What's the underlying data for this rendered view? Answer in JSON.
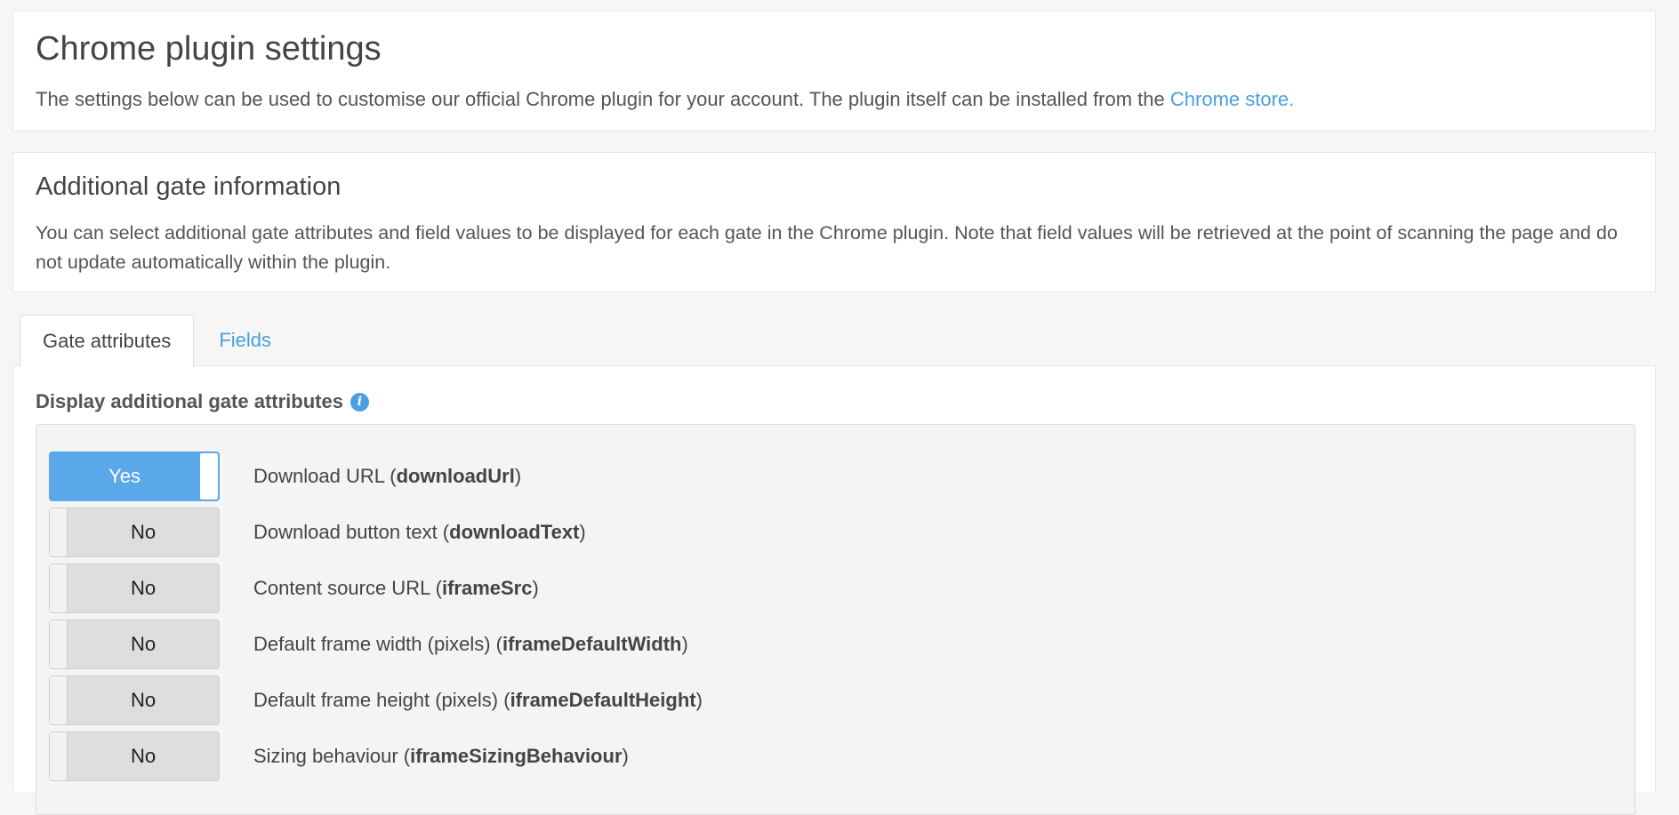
{
  "header": {
    "title": "Chrome plugin settings",
    "intro": "The settings below can be used to customise our official Chrome plugin for your account. The plugin itself can be installed from the ",
    "store_link": "Chrome store."
  },
  "gate_info": {
    "title": "Additional gate information",
    "description": "You can select additional gate attributes and field values to be displayed for each gate in the Chrome plugin. Note that field values will be retrieved at the point of scanning the page and do not update automatically within the plugin."
  },
  "tabs": [
    {
      "label": "Gate attributes",
      "active": true
    },
    {
      "label": "Fields",
      "active": false
    }
  ],
  "panel": {
    "heading": "Display additional gate attributes",
    "info_icon": "info-icon",
    "attributes": [
      {
        "toggle": "Yes",
        "on": true,
        "label": "Download URL (",
        "key": "downloadUrl",
        "close": ")"
      },
      {
        "toggle": "No",
        "on": false,
        "label": "Download button text (",
        "key": "downloadText",
        "close": ")"
      },
      {
        "toggle": "No",
        "on": false,
        "label": "Content source URL (",
        "key": "iframeSrc",
        "close": ")"
      },
      {
        "toggle": "No",
        "on": false,
        "label": "Default frame width (pixels) (",
        "key": "iframeDefaultWidth",
        "close": ")"
      },
      {
        "toggle": "No",
        "on": false,
        "label": "Default frame height (pixels) (",
        "key": "iframeDefaultHeight",
        "close": ")"
      },
      {
        "toggle": "No",
        "on": false,
        "label": "Sizing behaviour (",
        "key": "iframeSizingBehaviour",
        "close": ")"
      }
    ]
  },
  "colors": {
    "accent": "#4a9fe0",
    "toggle_on": "#5aa7ea",
    "toggle_off": "#dedede"
  }
}
